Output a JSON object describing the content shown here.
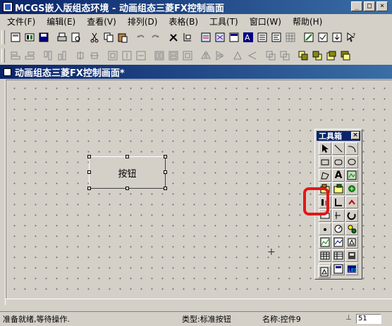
{
  "window": {
    "title": "MCGS嵌入版组态环境 - 动画组态三菱FX控制画面",
    "min": "_",
    "max": "□",
    "close": "×"
  },
  "menu": [
    "文件(F)",
    "编辑(E)",
    "查看(V)",
    "排列(D)",
    "表格(B)",
    "工具(T)",
    "窗口(W)",
    "帮助(H)"
  ],
  "document": {
    "title": "动画组态三菱FX控制画面*"
  },
  "canvas": {
    "button_label": "按钮",
    "cursor_symbol": "+"
  },
  "toolbox": {
    "title": "工具箱",
    "close": "×",
    "text_tool": "A"
  },
  "statusbar": {
    "message": "准备就绪,等待操作.",
    "type": "类型:标准按钮",
    "name": "名称:控件9",
    "value": "51"
  },
  "colors": {
    "title_bar": "#0a246a",
    "highlight": "#e01818",
    "face": "#d4d0c8"
  }
}
